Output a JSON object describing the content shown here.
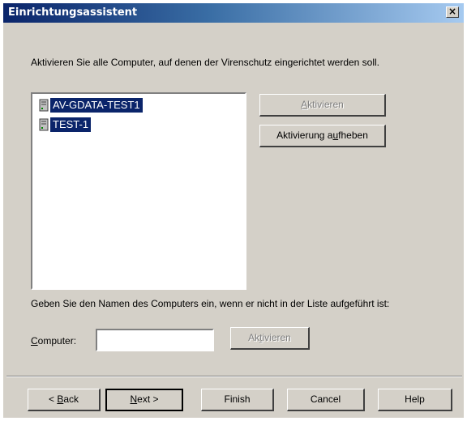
{
  "window": {
    "title": "Einrichtungsassistent",
    "close_symbol": "×"
  },
  "instruction": "Aktivieren Sie alle Computer, auf denen der Virenschutz eingerichtet werden soll.",
  "computer_list": [
    {
      "label": "AV-GDATA-TEST1",
      "icon": "computer-icon",
      "selected": true
    },
    {
      "label": "TEST-1",
      "icon": "computer-icon",
      "selected": true
    }
  ],
  "side_buttons": {
    "activate": {
      "pre": "",
      "mnemonic": "A",
      "post": "ktivieren",
      "enabled": false
    },
    "deactivate": {
      "pre": "Aktivierung a",
      "mnemonic": "u",
      "post": "fheben",
      "enabled": true
    }
  },
  "hint": "Geben Sie den Namen des Computers ein, wenn er nicht in der Liste aufgeführt ist:",
  "computer_field": {
    "label_mnemonic": "C",
    "label_rest": "omputer:",
    "value": "",
    "activate": {
      "pre": "Ak",
      "mnemonic": "t",
      "post": "ivieren",
      "enabled": false
    }
  },
  "footer": {
    "back": {
      "pre": "< ",
      "mnemonic": "B",
      "post": "ack"
    },
    "next": {
      "pre": "",
      "mnemonic": "N",
      "post": "ext >"
    },
    "finish": "Finish",
    "cancel": "Cancel",
    "help": "Help"
  },
  "colors": {
    "selection": "#0a246a",
    "dialog_bg": "#d4d0c8",
    "disabled_text": "#808080"
  }
}
